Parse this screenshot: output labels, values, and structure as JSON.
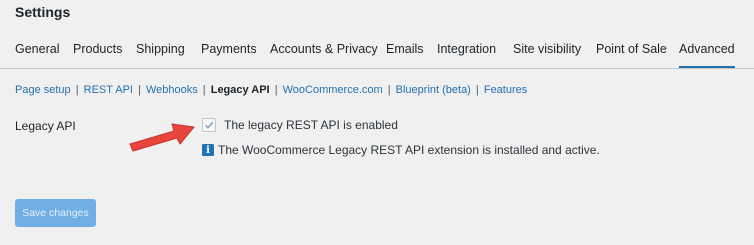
{
  "page": {
    "title": "Settings"
  },
  "tabs": [
    {
      "label": "General"
    },
    {
      "label": "Products"
    },
    {
      "label": "Shipping"
    },
    {
      "label": "Payments"
    },
    {
      "label": "Accounts & Privacy"
    },
    {
      "label": "Emails"
    },
    {
      "label": "Integration"
    },
    {
      "label": "Site visibility"
    },
    {
      "label": "Point of Sale"
    },
    {
      "label": "Advanced",
      "active": true
    }
  ],
  "sections": [
    {
      "label": "Page setup"
    },
    {
      "label": "REST API"
    },
    {
      "label": "Webhooks"
    },
    {
      "label": "Legacy API",
      "current": true
    },
    {
      "label": "WooCommerce.com"
    },
    {
      "label": "Blueprint (beta)"
    },
    {
      "label": "Features"
    }
  ],
  "section_separator": "|",
  "legacy_api": {
    "label": "Legacy API",
    "checkbox_label": "The legacy REST API is enabled",
    "checkbox_checked": true,
    "info_icon": "info-icon",
    "info_text": "The WooCommerce Legacy REST API extension is installed and active."
  },
  "actions": {
    "save_label": "Save changes"
  },
  "annotation": {
    "arrow_icon": "red-arrow-icon",
    "arrow_color": "#e8453c"
  },
  "colors": {
    "accent": "#2271b1",
    "background": "#f0f0f1",
    "save_button_disabled": "#72aee6"
  }
}
